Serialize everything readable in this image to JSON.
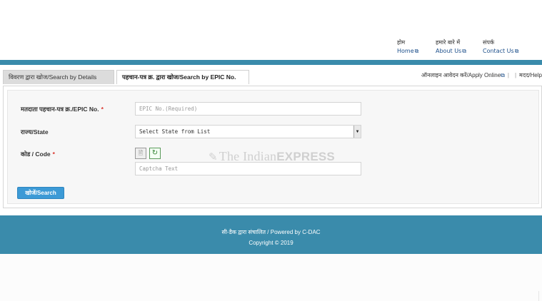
{
  "nav": {
    "home": {
      "hi": "होम",
      "en": "Home"
    },
    "about": {
      "hi": "हमारे बारे में",
      "en": "About Us"
    },
    "contact": {
      "hi": "संपर्क",
      "en": "Contact Us"
    },
    "external_icon": "external-link-icon"
  },
  "tabs": {
    "details": "विवरण द्वारा खोज/Search by Details",
    "epic": "पहचान-पत्र क्र. द्वारा खोज/Search by EPIC No."
  },
  "right_links": {
    "apply": "ऑनलाइन आवेदन करें/Apply Online",
    "help": "मदद/Help"
  },
  "form": {
    "epic_label": "मतदाता पहचान-पत्र क्र./EPIC No.",
    "epic_placeholder": "EPIC No.(Required)",
    "state_label": "राज्य/State",
    "state_selected": "Select State from List",
    "code_label": "कोड / Code",
    "captcha_placeholder": "Captcha Text",
    "required_mark": "*",
    "search_button": "खोजें/Search"
  },
  "watermark": {
    "part1": "The Indian",
    "part2": "EXPRESS"
  },
  "footer": {
    "powered": "सी-डैक द्वारा संचालित / Powered by C-DAC",
    "copyright": "Copyright © 2019"
  },
  "colors": {
    "accent": "#3a8bab",
    "button": "#3c9ad6",
    "required": "#d9342b",
    "link": "#1b4e8a"
  }
}
